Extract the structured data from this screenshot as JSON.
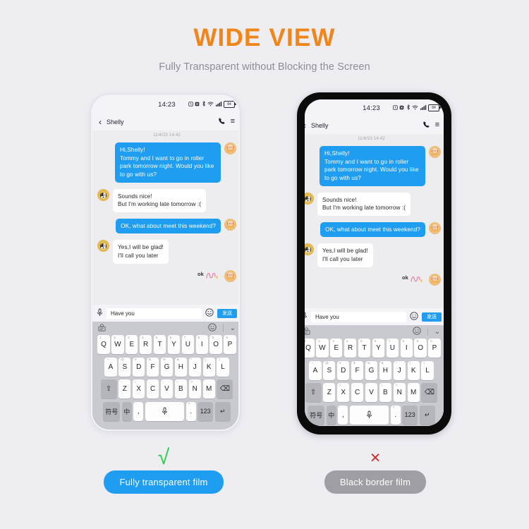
{
  "hero": {
    "title": "WIDE VIEW",
    "subtitle": "Fully Transparent without Blocking the Screen",
    "title_color": "#f08519"
  },
  "phone": {
    "statusbar": {
      "time": "14:23",
      "battery_level": "84",
      "icons": [
        "alarm-icon",
        "mute-icon",
        "bluetooth-icon",
        "wifi-icon",
        "signal-icon",
        "battery-icon"
      ]
    },
    "appbar": {
      "back": "‹",
      "contact": "Shelly",
      "call_icon": "✆",
      "menu_icon": "≡"
    },
    "chat": {
      "datestamp": "11/4/23 14:42",
      "messages": [
        {
          "side": "out",
          "text": "Hi,Shelly!\nTommy and I want to go in roller park tomorrow night. Would you like to go with us?"
        },
        {
          "side": "in",
          "text": "Sounds nice!\nBut I'm working late tomorrow :("
        },
        {
          "side": "out",
          "text": "OK, what about meet this weekend?"
        },
        {
          "side": "in",
          "text": "Yes,I will be glad!\nI'll call you later"
        }
      ],
      "sticker_text": "ok"
    },
    "inputbar": {
      "mic_icon": "Ʃ",
      "value": "Have you",
      "placeholder": "Have you",
      "emoji_icon": "☺",
      "send_label": "发送"
    },
    "keyboard": {
      "top": {
        "left_icon": "sticker-icon",
        "emoji_icon": "☺",
        "chevron_icon": "⌄"
      },
      "row1": [
        {
          "k": "Q",
          "s": "1"
        },
        {
          "k": "W",
          "s": "2"
        },
        {
          "k": "E",
          "s": "3"
        },
        {
          "k": "R",
          "s": "4"
        },
        {
          "k": "T",
          "s": "5"
        },
        {
          "k": "Y",
          "s": "6"
        },
        {
          "k": "U",
          "s": "7"
        },
        {
          "k": "I",
          "s": "8"
        },
        {
          "k": "O",
          "s": "9"
        },
        {
          "k": "P",
          "s": "0"
        }
      ],
      "row2": [
        {
          "k": "A",
          "s": "~"
        },
        {
          "k": "S",
          "s": "@"
        },
        {
          "k": "D",
          "s": "#"
        },
        {
          "k": "F",
          "s": "$"
        },
        {
          "k": "G",
          "s": "%"
        },
        {
          "k": "H",
          "s": "&"
        },
        {
          "k": "J",
          "s": "*"
        },
        {
          "k": "K",
          "s": "("
        },
        {
          "k": "L",
          "s": ")"
        }
      ],
      "row3": [
        {
          "k": "Z",
          "s": "-"
        },
        {
          "k": "X",
          "s": "/"
        },
        {
          "k": "C",
          "s": ":"
        },
        {
          "k": "V",
          "s": ";"
        },
        {
          "k": "B",
          "s": "!"
        },
        {
          "k": "N",
          "s": "?"
        },
        {
          "k": "M",
          "s": "’"
        }
      ],
      "shift_label": "⇧",
      "backspace_label": "⌫",
      "symbol_label": "符号",
      "lang_label": "中",
      "comma_label": ",",
      "comma_sup": "’",
      "space_label": "⌤",
      "period_label": ".",
      "period_sup": "?",
      "number_label": "123",
      "enter_label": "↵"
    }
  },
  "footer": {
    "left": {
      "mark": "√",
      "label": "Fully transparent film",
      "color": "#1e9df1",
      "mark_color": "#25cf45"
    },
    "right": {
      "mark": "×",
      "label": "Black border film",
      "color": "#9e9ea4",
      "mark_color": "#cf2424"
    }
  }
}
